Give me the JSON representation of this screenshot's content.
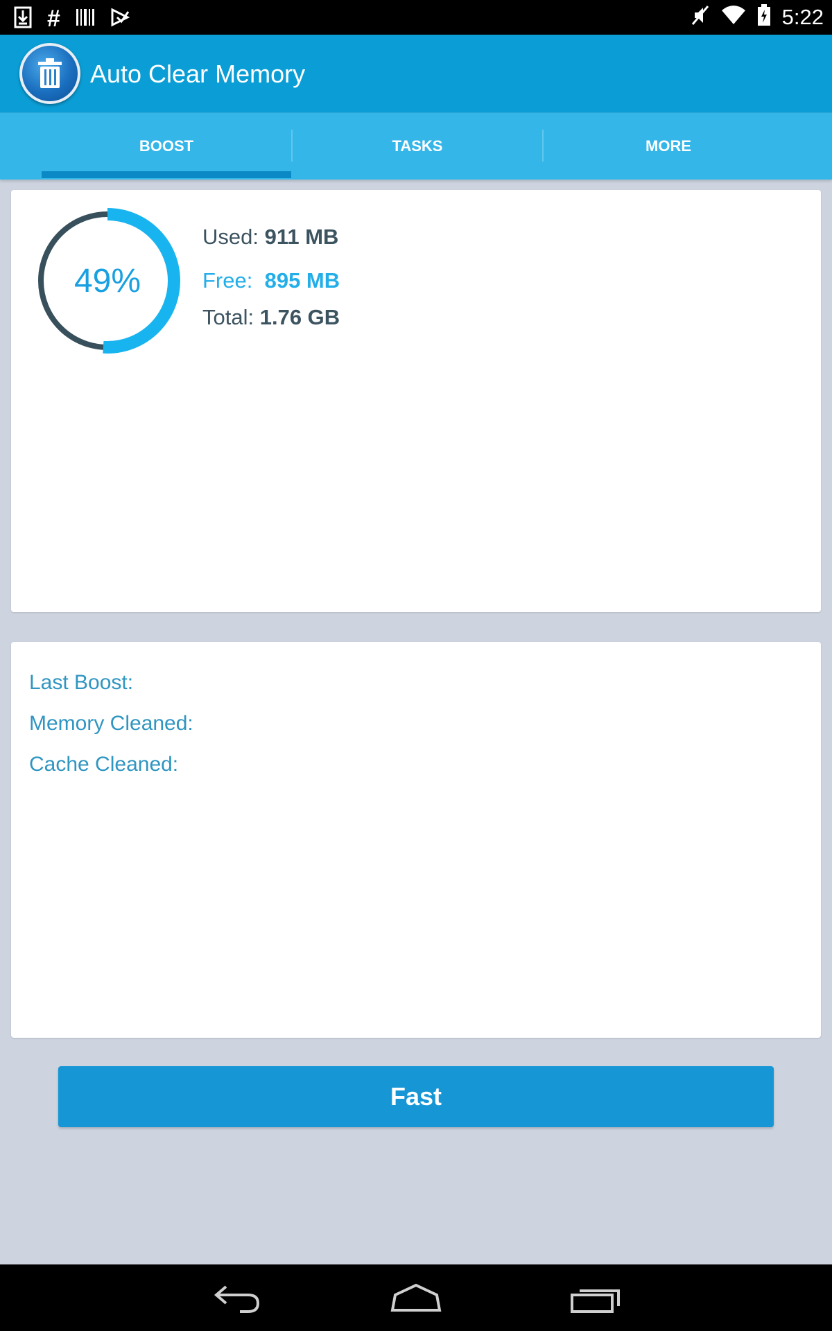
{
  "status_bar": {
    "time": "5:22",
    "left_icons": [
      "download-icon",
      "hash-icon",
      "barcode-icon",
      "play-store-icon"
    ],
    "right_icons": [
      "mute-icon",
      "wifi-icon",
      "battery-icon"
    ]
  },
  "app": {
    "title": "Auto Clear Memory",
    "logo_icon": "trash-can-icon"
  },
  "tabs": [
    {
      "label": "BOOST",
      "active": true
    },
    {
      "label": "TASKS",
      "active": false
    },
    {
      "label": "MORE",
      "active": false
    }
  ],
  "memory": {
    "percent_label": "49%",
    "used_fraction": 0.49,
    "used_label": "Used:",
    "used_value": "911 MB",
    "free_label": "Free:",
    "free_value": "895 MB",
    "total_label": "Total:",
    "total_value": "1.76 GB"
  },
  "boost_info": {
    "last_boost_label": "Last Boost:",
    "memory_cleaned_label": "Memory Cleaned:",
    "cache_cleaned_label": "Cache Cleaned:"
  },
  "action": {
    "fast_label": "Fast"
  },
  "colors": {
    "accent": "#18a0e0",
    "appbar": "#0b9ed6",
    "tabbar": "#35b6e8",
    "used_ring": "#38505c"
  },
  "nav_bar": [
    "back-icon",
    "home-icon",
    "recents-icon"
  ]
}
